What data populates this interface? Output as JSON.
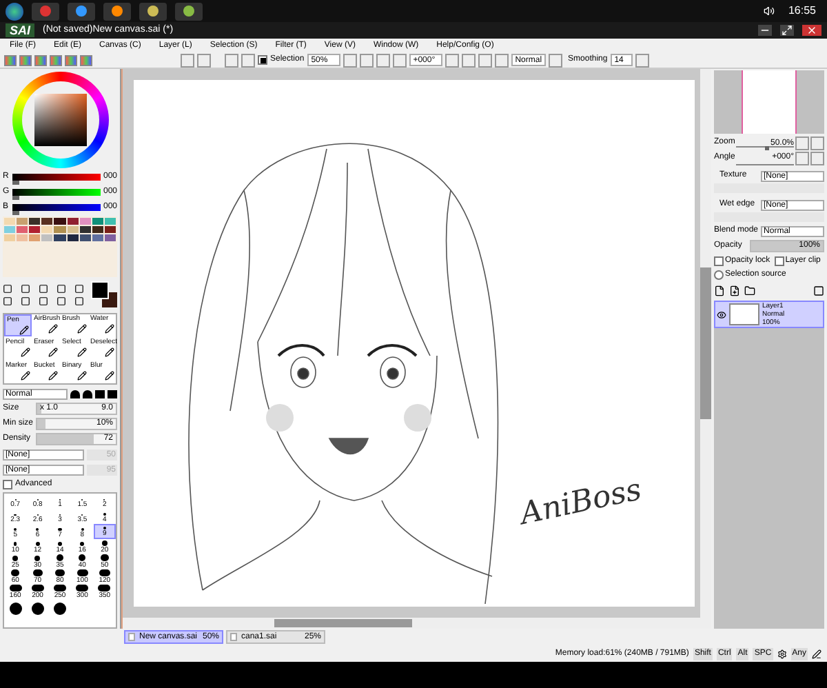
{
  "taskbar": {
    "clock": "16:55"
  },
  "window": {
    "logo": "SAI",
    "title": "(Not saved)New canvas.sai (*)"
  },
  "menu": [
    "File (F)",
    "Edit (E)",
    "Canvas (C)",
    "Layer (L)",
    "Selection (S)",
    "Filter (T)",
    "View (V)",
    "Window (W)",
    "Help/Config (O)"
  ],
  "toolbar": {
    "selection": {
      "label": "Selection",
      "checked": true
    },
    "zoom": "50%",
    "angle": "+000°",
    "blend": "Normal",
    "smoothing_label": "Smoothing",
    "smoothing": "14"
  },
  "color": {
    "sliders": [
      {
        "label": "R",
        "value": "000",
        "level": 0
      },
      {
        "label": "G",
        "value": "000",
        "level": 0
      },
      {
        "label": "B",
        "value": "000",
        "level": 0
      }
    ],
    "swatches": [
      {
        "kind": "background",
        "color": "#3a1a10"
      },
      {
        "kind": "foreground",
        "color": "#000000"
      }
    ]
  },
  "tools": [
    {
      "label": "Pen",
      "selected": true
    },
    {
      "label": "AirBrush",
      "selected": false
    },
    {
      "label": "Brush",
      "selected": false
    },
    {
      "label": "Water",
      "selected": false
    },
    {
      "label": "Pencil",
      "selected": false
    },
    {
      "label": "Eraser",
      "selected": false
    },
    {
      "label": "Select",
      "selected": false
    },
    {
      "label": "Deselect",
      "selected": false
    },
    {
      "label": "Marker",
      "selected": false
    },
    {
      "label": "Bucket",
      "selected": false
    },
    {
      "label": "Binary",
      "selected": false
    },
    {
      "label": "Blur",
      "selected": false
    }
  ],
  "brush": {
    "mode": "Normal",
    "size": {
      "label": "Size",
      "multiplier": "x 1.0",
      "value": "9.0",
      "level": 0.05
    },
    "min_size": {
      "label": "Min size",
      "value": "10%",
      "level": 0.1
    },
    "density": {
      "label": "Density",
      "value": "72",
      "level": 0.72
    },
    "texture_1": "[None]",
    "texture_1_value": "50",
    "texture_2": "[None]",
    "texture_2_value": "95",
    "advanced": {
      "label": "Advanced",
      "checked": false
    }
  },
  "brush_sizes": [
    {
      "label": "0.7",
      "selected": false
    },
    {
      "label": "0.8",
      "selected": false
    },
    {
      "label": "1",
      "selected": false
    },
    {
      "label": "1.5",
      "selected": false
    },
    {
      "label": "2",
      "selected": false
    },
    {
      "label": "2.3",
      "selected": false
    },
    {
      "label": "2.6",
      "selected": false
    },
    {
      "label": "3",
      "selected": false
    },
    {
      "label": "3.5",
      "selected": false
    },
    {
      "label": "4",
      "selected": false
    },
    {
      "label": "5",
      "selected": false
    },
    {
      "label": "6",
      "selected": false
    },
    {
      "label": "7",
      "selected": false
    },
    {
      "label": "8",
      "selected": false
    },
    {
      "label": "9",
      "selected": true
    },
    {
      "label": "10",
      "selected": false
    },
    {
      "label": "12",
      "selected": false
    },
    {
      "label": "14",
      "selected": false
    },
    {
      "label": "16",
      "selected": false
    },
    {
      "label": "20",
      "selected": false
    },
    {
      "label": "25",
      "selected": false
    },
    {
      "label": "30",
      "selected": false
    },
    {
      "label": "35",
      "selected": false
    },
    {
      "label": "40",
      "selected": false
    },
    {
      "label": "50",
      "selected": false
    },
    {
      "label": "60",
      "selected": false
    },
    {
      "label": "70",
      "selected": false
    },
    {
      "label": "80",
      "selected": false
    },
    {
      "label": "100",
      "selected": false
    },
    {
      "label": "120",
      "selected": false
    },
    {
      "label": "160",
      "selected": false
    },
    {
      "label": "200",
      "selected": false
    },
    {
      "label": "250",
      "selected": false
    },
    {
      "label": "300",
      "selected": false
    },
    {
      "label": "350",
      "selected": false
    },
    {
      "kind": "unlabeled"
    },
    {
      "kind": "unlabeled"
    },
    {
      "kind": "unlabeled"
    }
  ],
  "canvas": {
    "signature": "AniBoss"
  },
  "navigator": {
    "zoom": {
      "label": "Zoom",
      "value": "50.0%",
      "level": 0.5
    },
    "angle_label": "Angle",
    "angle": "+000°"
  },
  "texture": {
    "label": "Texture",
    "value": "[None]"
  },
  "wet_edge": {
    "label": "Wet edge",
    "value": "[None]"
  },
  "layer_props": {
    "blend_label": "Blend mode",
    "blend": "Normal",
    "opacity": {
      "label": "Opacity",
      "value": "100%",
      "level": 1
    },
    "checks": [
      {
        "label": "Opacity lock",
        "checked": false
      },
      {
        "label": "Layer clip",
        "checked": false
      },
      {
        "label": "Selection source",
        "checked": false
      }
    ]
  },
  "layers": [
    {
      "name": "Layer1",
      "mode": "Normal",
      "opacity": "100%",
      "selected": true,
      "visible": true
    }
  ],
  "tabs": [
    {
      "name": "New canvas.sai",
      "zoom": "50%",
      "selected": true
    },
    {
      "name": "cana1.sai",
      "zoom": "25%",
      "selected": false
    }
  ],
  "status": {
    "memory": "Memory load:61% (240MB / 791MB)",
    "keys": [
      "Shift",
      "Ctrl",
      "Alt",
      "SPC"
    ],
    "any": "Any"
  }
}
